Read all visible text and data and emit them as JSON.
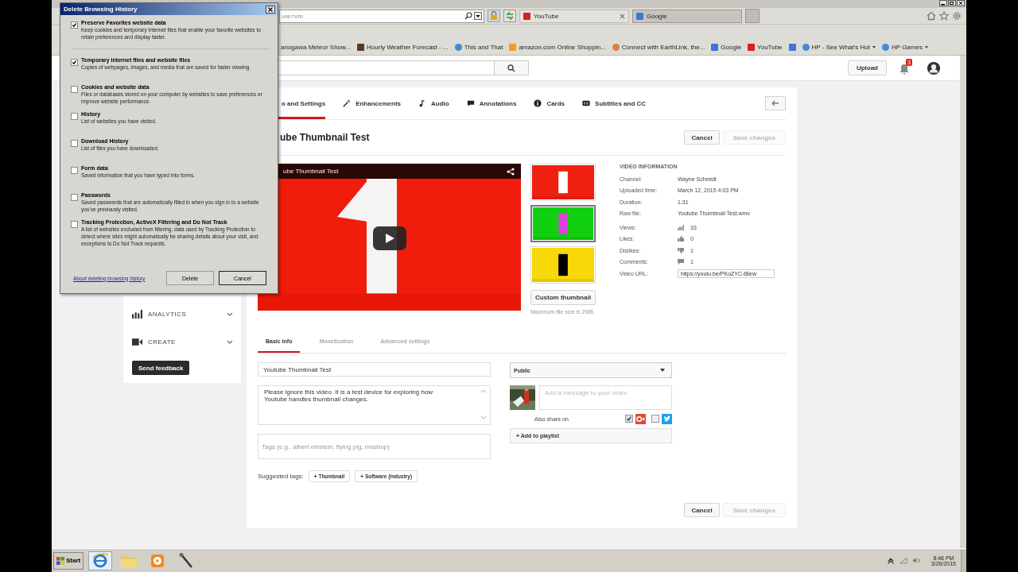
{
  "dialog": {
    "title": "Delete Browsing History",
    "options": [
      {
        "label": "Preserve Favorites website data",
        "description": "Keep cookies and temporary Internet files that enable your favorite websites to retain preferences and display faster.",
        "checked": true
      },
      {
        "label": "Temporary Internet files and website files",
        "description": "Copies of webpages, images, and media that are saved for faster viewing.",
        "checked": true
      },
      {
        "label": "Cookies and website data",
        "description": "Files or databases stored on your computer by websites to save preferences or improve website performance.",
        "checked": false
      },
      {
        "label": "History",
        "description": "List of websites you have visited.",
        "checked": false
      },
      {
        "label": "Download History",
        "description": "List of files you have downloaded.",
        "checked": false
      },
      {
        "label": "Form data",
        "description": "Saved information that you have typed into forms.",
        "checked": false
      },
      {
        "label": "Passwords",
        "description": "Saved passwords that are automatically filled in when you sign in to a website you've previously visited.",
        "checked": false
      },
      {
        "label": "Tracking Protection, ActiveX Filtering and Do Not Track",
        "description": "A list of websites excluded from filtering, data used by Tracking Protection to detect where sites might automatically be sharing details about your visit, and exceptions to Do Not Track requests.",
        "checked": false
      }
    ],
    "link": "About deleting browsing history",
    "buttons": [
      "Delete",
      "Cancel"
    ]
  },
  "browser": {
    "address": "ure=vm",
    "tabs": [
      {
        "label": "YouTube",
        "kind": "youtube",
        "selected": true
      },
      {
        "label": "Google",
        "kind": "google",
        "selected": false
      }
    ],
    "favorites": [
      {
        "label": "anogawa Meteor Show...",
        "kind": "none",
        "dropdown": false
      },
      {
        "label": "Hourly Weather Forecast - ...",
        "kind": "weather",
        "dropdown": false
      },
      {
        "label": "This and That",
        "kind": "ie",
        "dropdown": false
      },
      {
        "label": "amazon.com Online Shoppin...",
        "kind": "amazon",
        "dropdown": false
      },
      {
        "label": "Connect with EarthLink, the...",
        "kind": "earthlink",
        "dropdown": false
      },
      {
        "label": "Google",
        "kind": "google",
        "dropdown": false
      },
      {
        "label": "YouTube",
        "kind": "youtube",
        "dropdown": false
      },
      {
        "kind": "google",
        "dropdown": false
      },
      {
        "label": "HP - See What's Hot",
        "kind": "ie",
        "dropdown": true
      },
      {
        "label": "HP Games",
        "kind": "ie",
        "dropdown": true
      }
    ]
  },
  "header": {
    "upload": "Upload",
    "notifications": "3"
  },
  "sidebar": {
    "items": [
      {
        "label": "ANALYTICS",
        "kind": "analytics"
      },
      {
        "label": "CREATE",
        "kind": "create"
      }
    ],
    "feedback": "Send feedback"
  },
  "editor": {
    "tabs": [
      {
        "label": "o and Settings",
        "kind": "info",
        "selected": true
      },
      {
        "label": "Enhancements",
        "kind": "wand",
        "selected": false
      },
      {
        "label": "Audio",
        "kind": "note",
        "selected": false
      },
      {
        "label": "Annotations",
        "kind": "speech",
        "selected": false
      },
      {
        "label": "Cards",
        "kind": "i",
        "selected": false
      },
      {
        "label": "Subtitles and CC",
        "kind": "cc",
        "selected": false
      }
    ],
    "title": "ube Thumbnail Test",
    "buttons": [
      {
        "label": "Cancel",
        "disabled": false
      },
      {
        "label": "Save changes",
        "disabled": true
      }
    ],
    "video_title": "ube Thumbnail Test",
    "thumbnails": [
      {
        "kind": "picture",
        "selected": false
      },
      {
        "kind": "picture",
        "selected": true
      },
      {
        "kind": "picture",
        "selected": false
      }
    ],
    "custom_thumbnail": "Custom thumbnail",
    "file_note": "Maximum file size is 2MB.",
    "info_heading": "VIDEO INFORMATION",
    "info": [
      {
        "label": "Channel:",
        "value": "Wayne Schmidt",
        "kind": "text"
      },
      {
        "label": "Uploaded time:",
        "value": "March 12, 2015 4:03 PM",
        "kind": "text"
      },
      {
        "label": "Duration:",
        "value": "1:31",
        "kind": "text"
      },
      {
        "label": "Raw file:",
        "value": "Youtube Thumbnail Test.wmv",
        "kind": "text"
      },
      {
        "label": "Views:",
        "value": "33",
        "kind": "views"
      },
      {
        "label": "Likes:",
        "value": "0",
        "kind": "likes"
      },
      {
        "label": "Dislikes:",
        "value": "1",
        "kind": "dislikes"
      },
      {
        "label": "Comments:",
        "value": "1",
        "kind": "comments"
      },
      {
        "label": "Video URL:",
        "value": "https://youtu.be/PKoZYC-tBew",
        "kind": "field"
      }
    ],
    "form_tabs": [
      {
        "label": "Basic info",
        "selected": true
      },
      {
        "label": "Monetization",
        "selected": false
      },
      {
        "label": "Advanced settings",
        "selected": false
      }
    ],
    "title_value": "Youtube Thumbnail Test",
    "description": "Please ignore this video. It is a test device for exploring how Youtube handles thumbnail changes.",
    "tags_placeholder": "Tags (e.g., albert einstein, flying pig, mashup)",
    "suggested_label": "Suggested tags:",
    "suggested": [
      "+ Thumbnail",
      "+ Software (Industry)"
    ],
    "privacy": "Public",
    "message_placeholder": "Add a message to your video",
    "share_label": "Also share on",
    "share": [
      {
        "kind": "gplus",
        "checked": true
      },
      {
        "kind": "twitter",
        "checked": false
      }
    ],
    "playlist": "+ Add to playlist",
    "bottom_buttons": [
      {
        "label": "Cancel",
        "disabled": false
      },
      {
        "label": "Save changes",
        "disabled": true
      }
    ]
  },
  "taskbar": {
    "start": "Start",
    "time": "8:46 PM",
    "date": "3/26/2015"
  }
}
